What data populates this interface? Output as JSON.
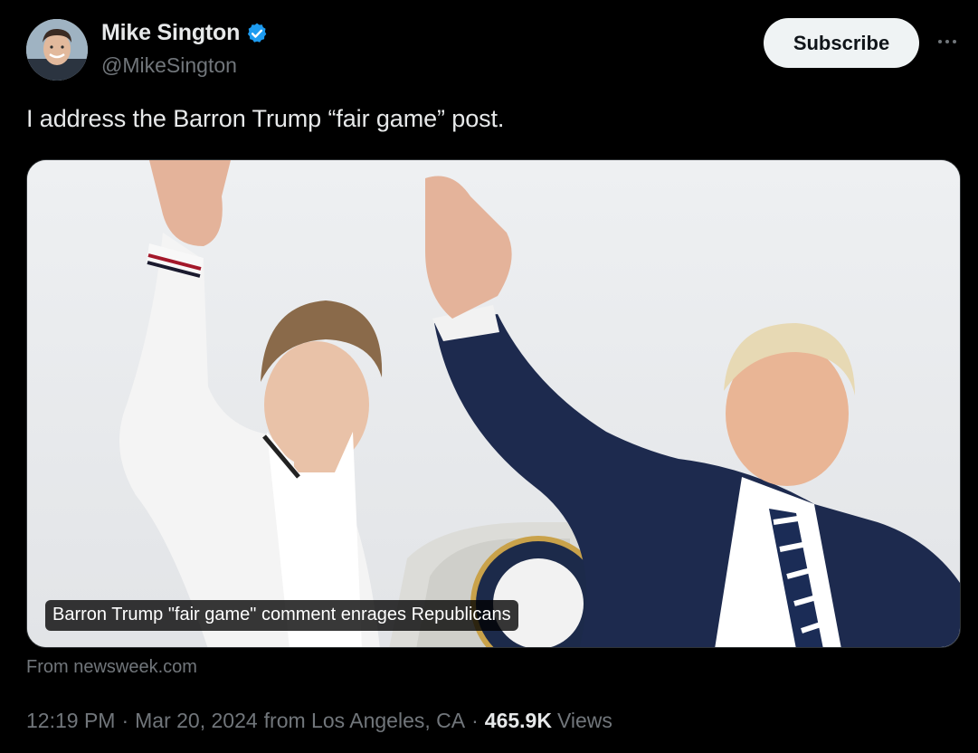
{
  "author": {
    "name": "Mike Sington",
    "handle": "@MikeSington",
    "verified_color": "#1d9bf0"
  },
  "actions": {
    "subscribe_label": "Subscribe",
    "more_icon": "more-horizontal-icon"
  },
  "tweet": {
    "text": "I address the Barron Trump “fair game” post."
  },
  "card": {
    "caption": "Barron Trump \"fair game\" comment enrages Republicans",
    "source": "From newsweek.com"
  },
  "meta": {
    "time": "12:19 PM",
    "separator": "·",
    "date": "Mar 20, 2024",
    "location": "from Los Angeles, CA",
    "views_count": "465.9K",
    "views_label": "Views"
  },
  "colors": {
    "background": "#000000",
    "primary_text": "#e7e9ea",
    "secondary_text": "#71767b",
    "button_bg": "#eff3f4"
  }
}
